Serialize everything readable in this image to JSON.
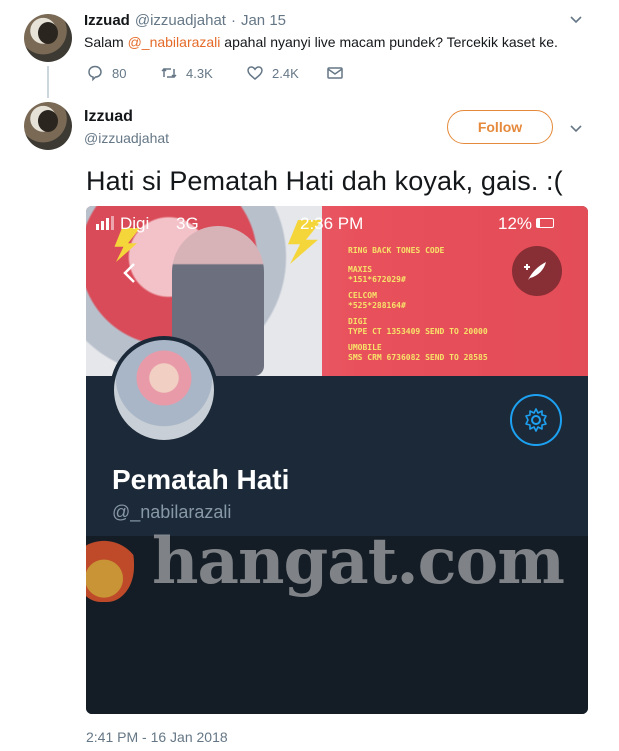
{
  "tweet1": {
    "name": "Izzuad",
    "handle": "@izzuadjahat",
    "sep": "·",
    "date": "Jan 15",
    "text_before": "Salam ",
    "mention": "@_nabilarazali",
    "text_after": " apahal nyanyi live macam pundek? Tercekik kaset ke.",
    "replies": "80",
    "retweets": "4.3K",
    "likes": "2.4K"
  },
  "tweet2": {
    "name": "Izzuad",
    "handle": "@izzuadjahat",
    "follow_label": "Follow",
    "text": "Hati si Pematah Hati dah koyak, gais. :(",
    "timestamp": "2:41 PM - 16 Jan 2018"
  },
  "screenshot": {
    "carrier": "Digi",
    "network": "3G",
    "time": "2:36 PM",
    "battery": "12%",
    "banner_heading": "RING BACK TONES CODE",
    "banner_lines": [
      "MAXIS",
      "*151*672029#",
      "CELCOM",
      "*525*288164#",
      "DIGI",
      "TYPE CT 1353409 SEND TO 20000",
      "UMOBILE",
      "SMS CRM 6736082 SEND TO 28585"
    ],
    "profile_name": "Pematah Hati",
    "profile_handle": "@_nabilarazali",
    "watermark": "hangat.com"
  },
  "colors": {
    "accent": "#e58a3c",
    "muted": "#657786",
    "banner": "#e8505b",
    "profile_bg": "#1c2938"
  }
}
